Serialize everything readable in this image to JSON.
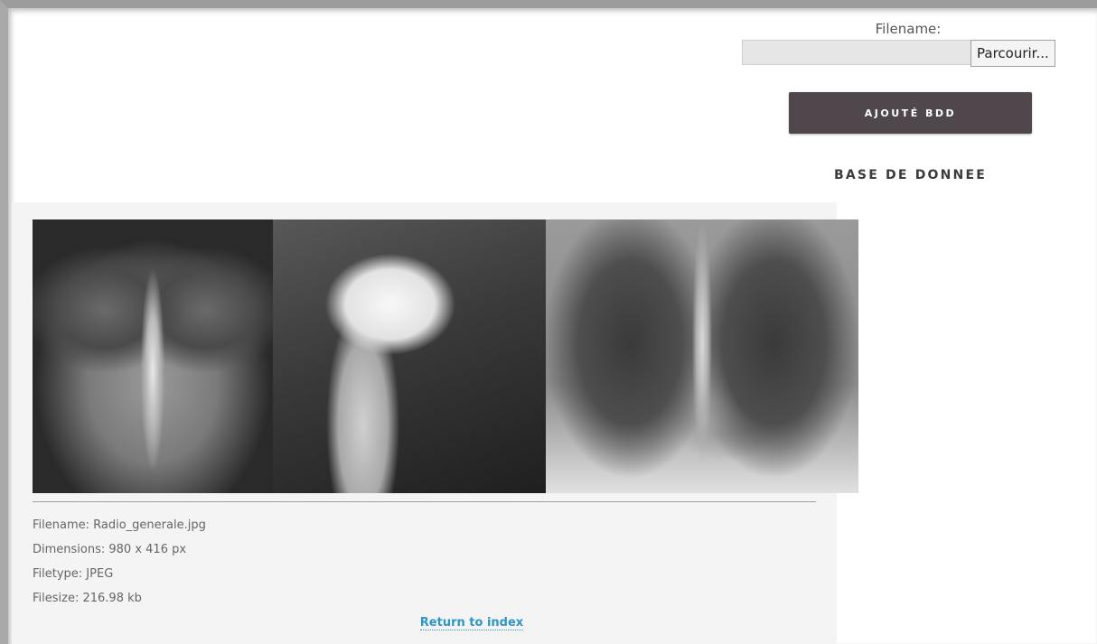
{
  "upload": {
    "label": "Filename:",
    "file_value": "",
    "browse_label": "Parcourir..."
  },
  "actions": {
    "add_button": "AJOUTÉ BDD",
    "database_link": "BASE DE DONNEE"
  },
  "image": {
    "filename_line": "Filename: Radio_generale.jpg",
    "dimensions_line": "Dimensions: 980 x 416 px",
    "filetype_line": "Filetype: JPEG",
    "filesize_line": "Filesize: 216.98 kb"
  },
  "nav": {
    "return_label": "Return to index"
  },
  "colors": {
    "button_bg": "#4f474c",
    "link": "#2d96c4",
    "panel_bg": "#f4f4f4"
  }
}
